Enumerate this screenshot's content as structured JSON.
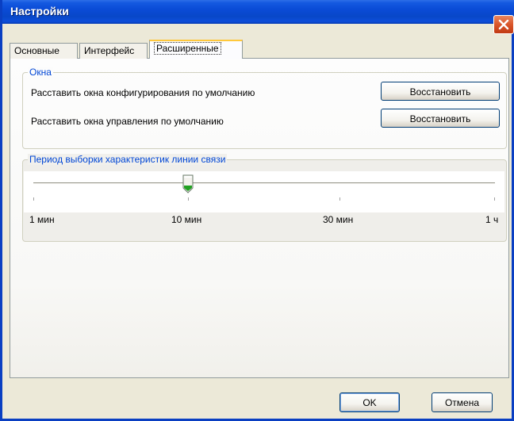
{
  "window": {
    "title": "Настройки",
    "close_icon": "close-icon"
  },
  "tabs": [
    {
      "label": "Основные",
      "active": false
    },
    {
      "label": "Интерфейс",
      "active": false
    },
    {
      "label": "Расширенные",
      "active": true
    }
  ],
  "windows_group": {
    "legend": "Окна",
    "rows": [
      {
        "label": "Расставить окна конфигурирования по умолчанию",
        "button": "Восстановить"
      },
      {
        "label": "Расставить окна управления по умолчанию",
        "button": "Восстановить"
      }
    ]
  },
  "sampling_group": {
    "legend": "Период выборки характеристик линии связи",
    "ticks": [
      "1 мин",
      "10 мин",
      "30 мин",
      "1 ч"
    ],
    "selected": "10 мин"
  },
  "footer": {
    "ok_label": "OK",
    "cancel_label": "Отмена"
  },
  "colors": {
    "title_bar": "#0A4BD6",
    "dialog_bg": "#ECE9D8",
    "group_legend": "#0046D5",
    "active_tab_highlight": "#FFC83C",
    "close_button": "#D9552A"
  }
}
